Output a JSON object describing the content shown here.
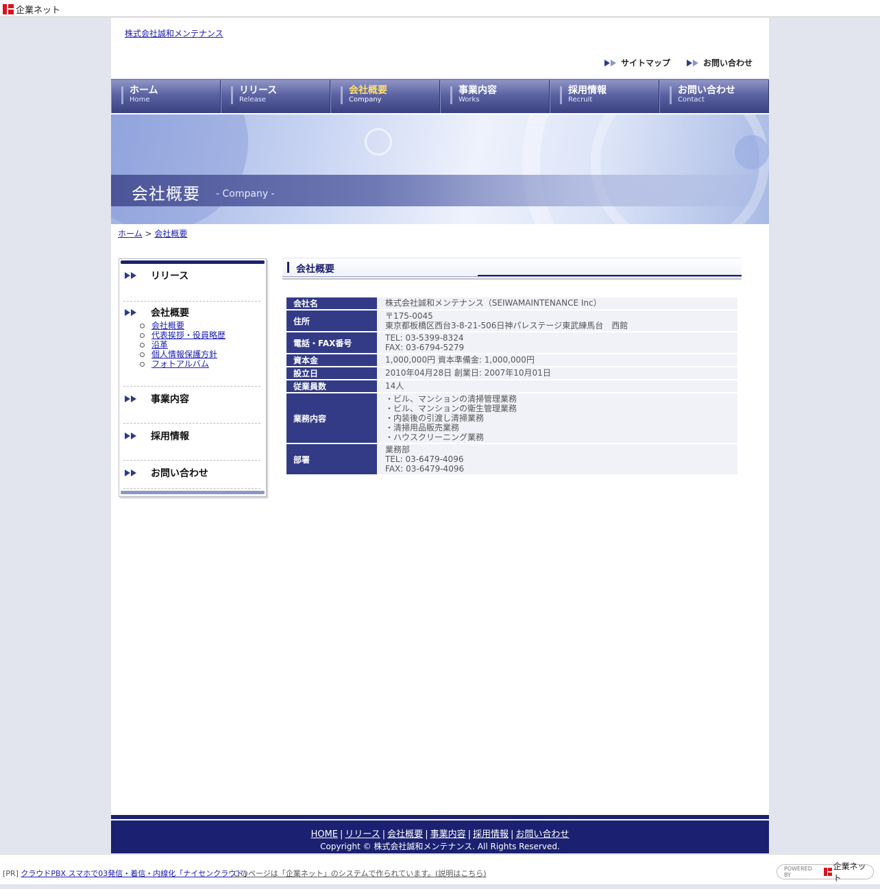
{
  "topbar": {
    "logo_text": "企業ネット"
  },
  "header": {
    "site_name": "株式会社誠和メンテナンス",
    "util_links": [
      "サイトマップ",
      "お問い合わせ"
    ]
  },
  "nav": [
    {
      "jp": "ホーム",
      "en": "Home"
    },
    {
      "jp": "リリース",
      "en": "Release"
    },
    {
      "jp": "会社概要",
      "en": "Company"
    },
    {
      "jp": "事業内容",
      "en": "Works"
    },
    {
      "jp": "採用情報",
      "en": "Recruit"
    },
    {
      "jp": "お問い合わせ",
      "en": "Contact"
    }
  ],
  "hero": {
    "title": "会社概要",
    "subtitle": "- Company -"
  },
  "breadcrumb": {
    "home": "ホーム",
    "sep": ">",
    "current": "会社概要"
  },
  "sidebar": {
    "release": "リリース",
    "company": "会社概要",
    "company_sub": [
      "会社概要",
      "代表挨拶・役員略歴",
      "沿革",
      "個人情報保護方針",
      "フォトアルバム"
    ],
    "works": "事業内容",
    "recruit": "採用情報",
    "contact": "お問い合わせ"
  },
  "content": {
    "title": "会社概要",
    "rows": [
      {
        "label": "会社名",
        "lines": [
          "株式会社誠和メンテナンス（SEIWAMAINTENANCE Inc）"
        ]
      },
      {
        "label": "住所",
        "lines": [
          "〒175-0045",
          "東京都板橋区西台3-8-21-506日神パレステージ東武練馬台　西館"
        ]
      },
      {
        "label": "電話・FAX番号",
        "lines": [
          "TEL: 03-5399-8324",
          "FAX: 03-6794-5279"
        ]
      },
      {
        "label": "資本金",
        "lines": [
          "1,000,000円 資本準備金: 1,000,000円"
        ]
      },
      {
        "label": "設立日",
        "lines": [
          "2010年04月28日 創業日: 2007年10月01日"
        ]
      },
      {
        "label": "従業員数",
        "lines": [
          "14人"
        ]
      },
      {
        "label": "業務内容",
        "lines": [
          "・ビル、マンションの清掃管理業務",
          "・ビル、マンションの衛生管理業務",
          "・内装後の引渡し清掃業務",
          "・清掃用品販売業務",
          "・ハウスクリーニング業務"
        ]
      },
      {
        "label": "部署",
        "lines": [
          "業務部",
          "TEL: 03-6479-4096",
          "FAX: 03-6479-4096"
        ]
      }
    ]
  },
  "footer": {
    "links": [
      "HOME",
      "リリース",
      "会社概要",
      "事業内容",
      "採用情報",
      "お問い合わせ"
    ],
    "sep": "|",
    "copyright": "Copyright © 株式会社誠和メンテナンス. All Rights Reserved."
  },
  "bottombar": {
    "pr_tag": "[PR]",
    "pr_link": "クラウドPBX スマホで03発信・着信・内線化「ナイセンクラウド」",
    "note": "このページは「企業ネット」のシステムで作られています。(説明はこちら)",
    "powered_by": "POWERED BY",
    "powered_brand": "企業ネット"
  },
  "colors": {
    "primary": "#1b2170",
    "nav_active": "#ffdf6a",
    "table_header": "#333b87"
  }
}
